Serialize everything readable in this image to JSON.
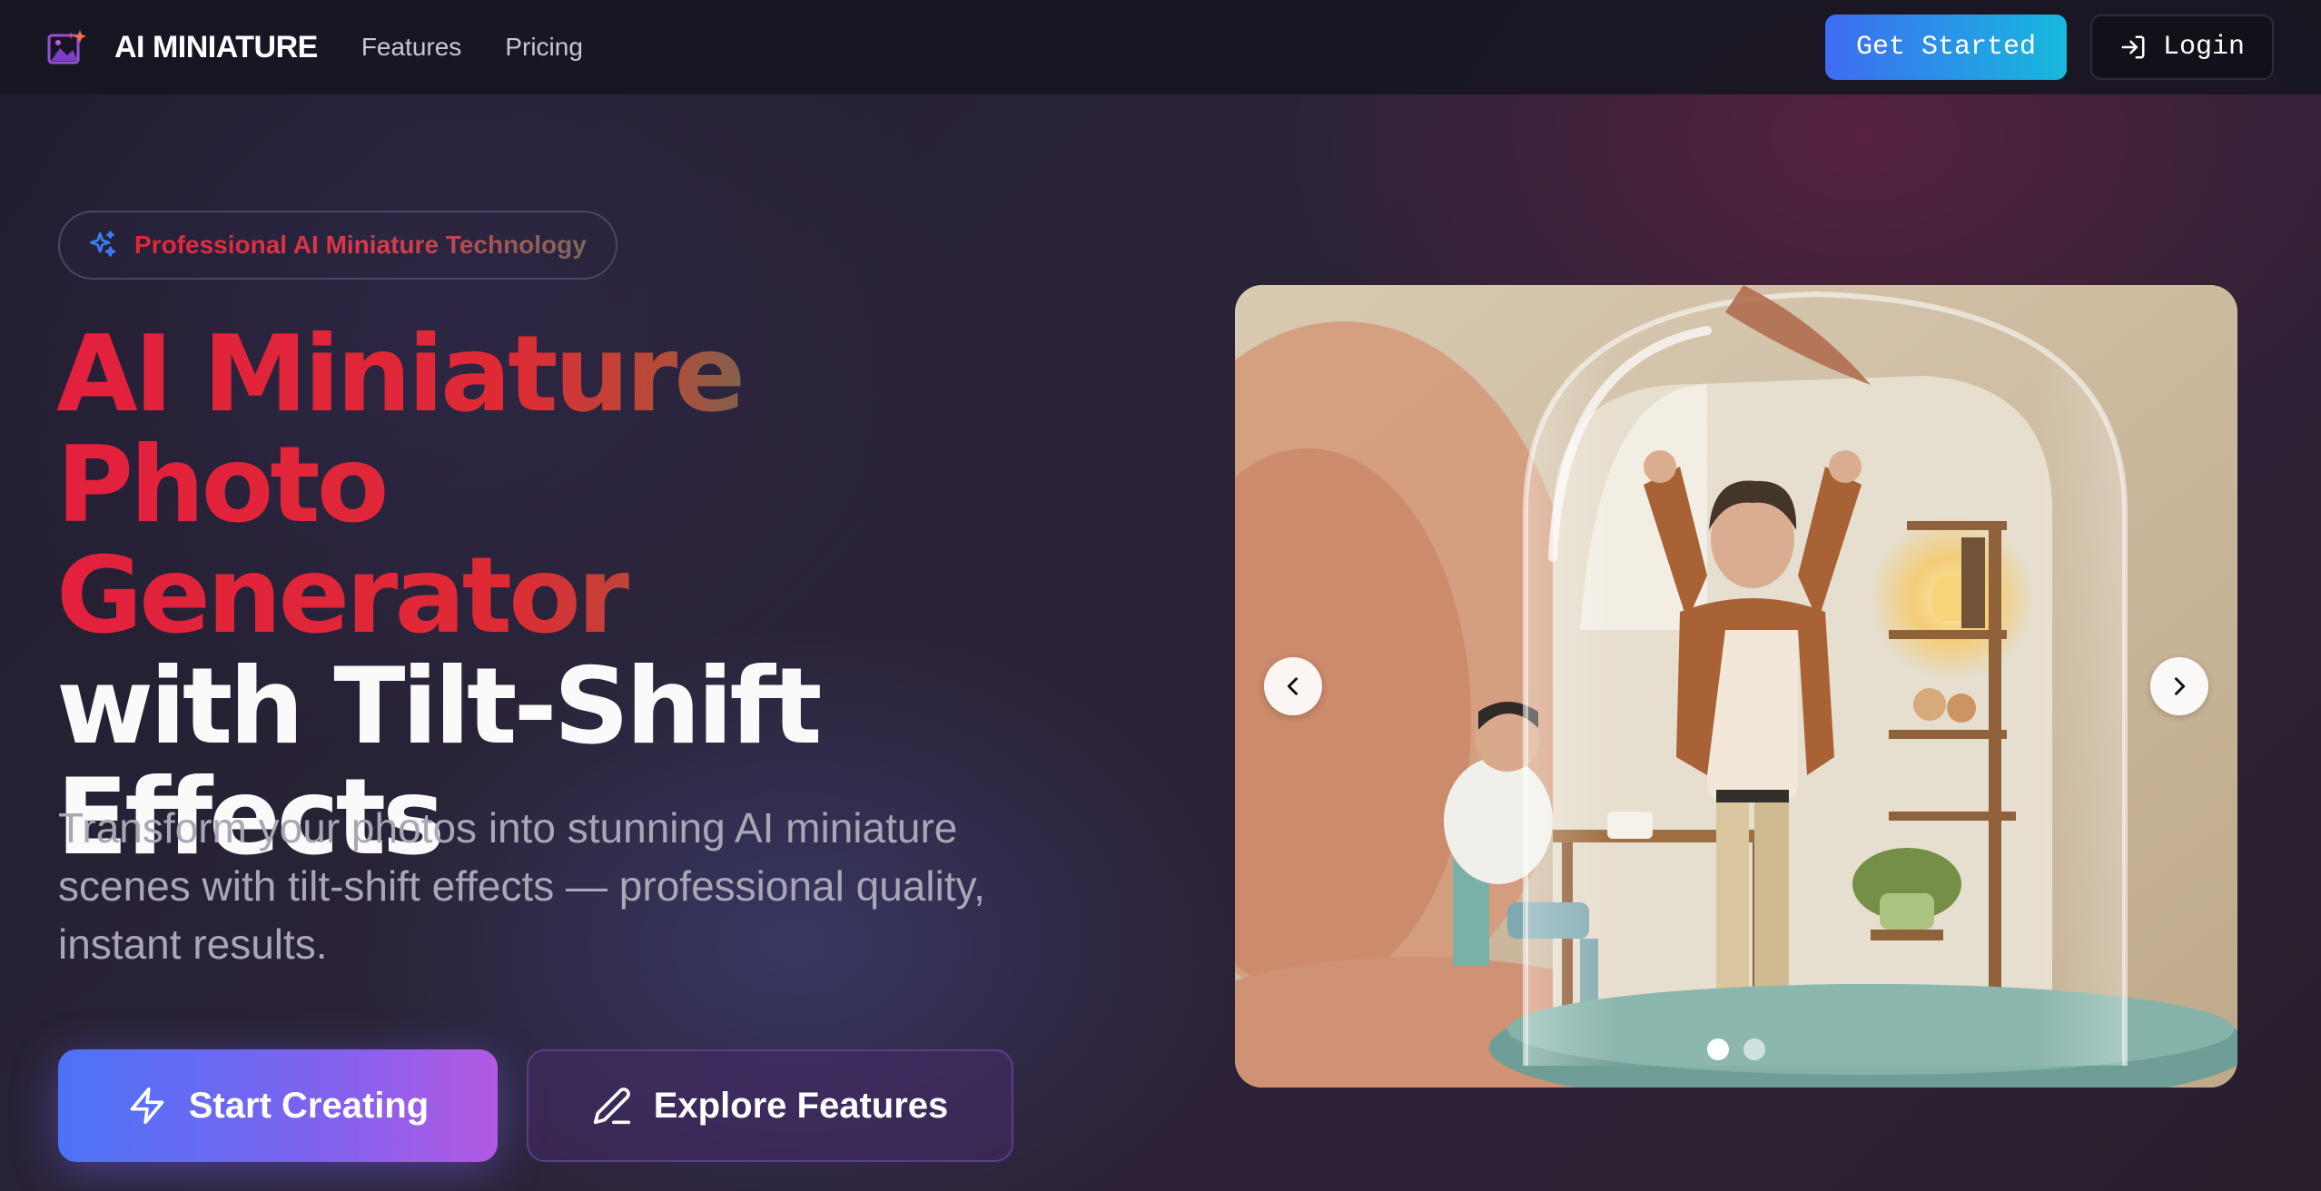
{
  "nav": {
    "brand": "AI MINIATURE",
    "links": [
      "Features",
      "Pricing"
    ],
    "get_started": "Get Started",
    "login": "Login"
  },
  "hero": {
    "badge": "Professional AI Miniature Technology",
    "headline_gradient_line1": "AI Miniature Photo",
    "headline_gradient_line2": "Generator",
    "headline_white_line1": "with Tilt-Shift",
    "headline_white_line2": "Effects",
    "subtitle": "Transform your photos into stunning AI miniature scenes with tilt-shift effects — professional quality, instant results.",
    "cta_primary": "Start Creating",
    "cta_secondary": "Explore Features"
  },
  "carousel": {
    "slide_count": 2,
    "active_slide": 1
  },
  "icons": {
    "logo": "image-sparkle-icon",
    "login": "login-arrow-icon",
    "badge": "sparkles-icon",
    "cta_primary": "lightning-icon",
    "cta_secondary": "pencil-icon",
    "prev": "chevron-left-icon",
    "next": "chevron-right-icon"
  },
  "colors": {
    "background": "#1f1b2b",
    "accent_red": "#e3203e",
    "get_started_gradient": [
      "#3f6cf2",
      "#16b9dd"
    ],
    "cta_gradient": [
      "#4c73f6",
      "#b25ae3"
    ]
  }
}
